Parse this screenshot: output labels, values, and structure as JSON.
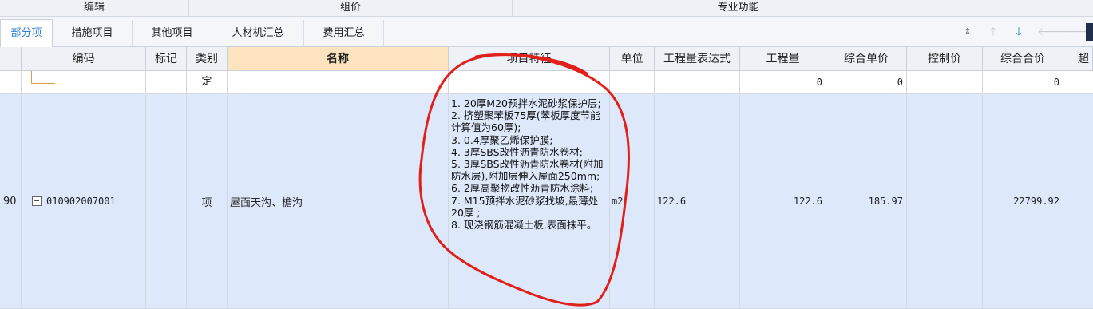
{
  "ribbon": {
    "groups": [
      "编辑",
      "组价",
      "专业功能"
    ]
  },
  "tabs": [
    "部分项",
    "措施项目",
    "其他项目",
    "人材机汇总",
    "费用汇总"
  ],
  "toolbar": {
    "icons": [
      "expand-toggle-icon",
      "arrow-up-icon",
      "arrow-down-icon",
      "arrow-left-icon",
      "arrow-right-icon"
    ],
    "accent": "#2a7fd4"
  },
  "table": {
    "headers": [
      "编码",
      "标记",
      "类别",
      "名称",
      "项目特征",
      "单位",
      "工程量表达式",
      "工程量",
      "综合单价",
      "控制价",
      "综合合价",
      "超"
    ],
    "rows": [
      {
        "row_no": "",
        "code": "",
        "mark": "",
        "type": "定",
        "name": "",
        "feature": "",
        "unit": "",
        "expr": "",
        "qty": "0",
        "unit_price": "0",
        "control_price": "",
        "total": "0"
      },
      {
        "row_no": "90",
        "code": "010902007001",
        "mark": "",
        "type": "项",
        "name": "屋面天沟、檐沟",
        "feature": "1. 20厚M20预拌水泥砂浆保护层;\n2. 挤塑聚苯板75厚(苯板厚度节能计算值为60厚);\n3. 0.4厚聚乙烯保护膜;\n4. 3厚SBS改性沥青防水卷材;\n5. 3厚SBS改性沥青防水卷材(附加防水层),附加层伸入屋面250mm;\n6. 2厚高聚物改性沥青防水涂料;\n7. M15预拌水泥砂浆找坡,最薄处20厚 ;\n8. 现浇钢筋混凝土板,表面抹平。",
        "unit": "m2",
        "expr": "122.6",
        "qty": "122.6",
        "unit_price": "185.97",
        "control_price": "",
        "total": "22799.92"
      }
    ],
    "colors": {
      "selected_row": "#dde8fb",
      "selected_header": "#fde4bf",
      "annotation": "#e0201a"
    }
  }
}
